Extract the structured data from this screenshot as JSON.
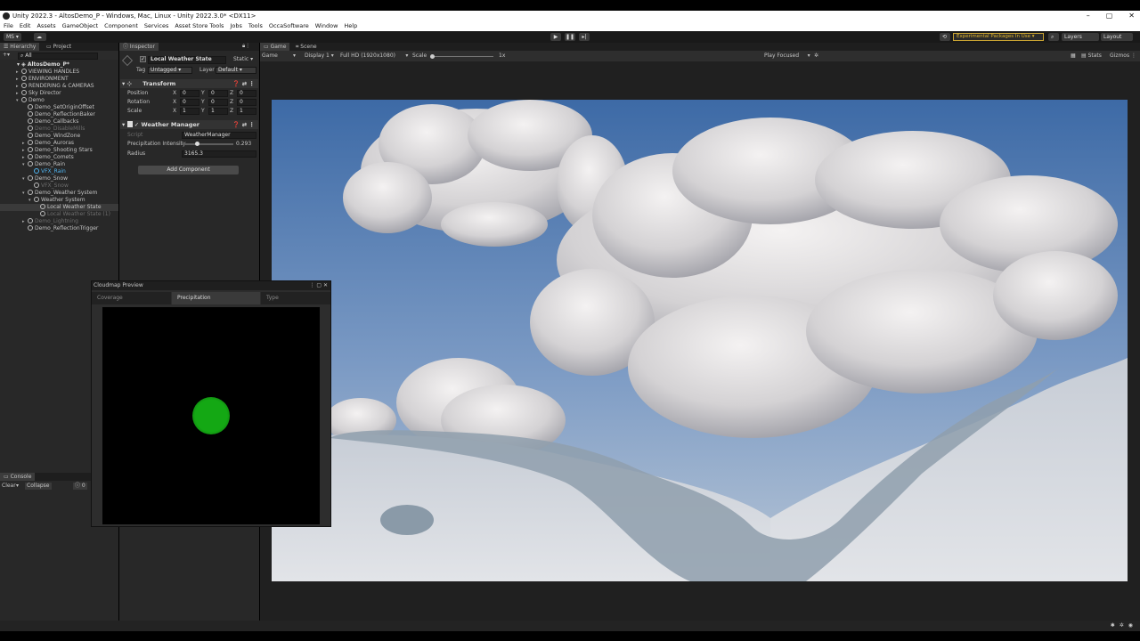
{
  "window": {
    "title": "Unity 2022.3 - AltosDemo_P - Windows, Mac, Linux - Unity 2022.3.0* <DX11>",
    "controls": [
      "–",
      "▢",
      "✕"
    ]
  },
  "menu": [
    "File",
    "Edit",
    "Assets",
    "GameObject",
    "Component",
    "Services",
    "Asset Store Tools",
    "Jobs",
    "Tools",
    "OccaSoftware",
    "Window",
    "Help"
  ],
  "toolbar": {
    "account": "MS ▾",
    "experimental": "Experimental Packages In Use ▾",
    "layers": "Layers",
    "layout": "Layout"
  },
  "hierarchy": {
    "tab": "Hierarchy",
    "project_tab": "Project",
    "search_placeholder": "All",
    "scene": "AltosDemo_P*",
    "items": [
      {
        "label": "VIEWING HANDLES",
        "indent": 1,
        "arrow": "▸"
      },
      {
        "label": "ENVIRONMENT",
        "indent": 1,
        "arrow": "▸"
      },
      {
        "label": "RENDERING & CAMERAS",
        "indent": 1,
        "arrow": "▸"
      },
      {
        "label": "Sky Director",
        "indent": 1,
        "arrow": "▸"
      },
      {
        "label": "Demo",
        "indent": 1,
        "arrow": "▾"
      },
      {
        "label": "Demo_SetOriginOffset",
        "indent": 2,
        "arrow": ""
      },
      {
        "label": "Demo_ReflectionBaker",
        "indent": 2,
        "arrow": ""
      },
      {
        "label": "Demo_Callbacks",
        "indent": 2,
        "arrow": ""
      },
      {
        "label": "Demo_DisableMills",
        "indent": 2,
        "arrow": "",
        "dim": true
      },
      {
        "label": "Demo_WindZone",
        "indent": 2,
        "arrow": ""
      },
      {
        "label": "Demo_Auroras",
        "indent": 2,
        "arrow": "▸"
      },
      {
        "label": "Demo_Shooting Stars",
        "indent": 2,
        "arrow": "▸"
      },
      {
        "label": "Demo_Comets",
        "indent": 2,
        "arrow": "▸"
      },
      {
        "label": "Demo_Rain",
        "indent": 2,
        "arrow": "▾"
      },
      {
        "label": "VFX_Rain",
        "indent": 3,
        "arrow": "",
        "blue": true
      },
      {
        "label": "Demo_Snow",
        "indent": 2,
        "arrow": "▾"
      },
      {
        "label": "VFX_Snow",
        "indent": 3,
        "arrow": "",
        "dim": true
      },
      {
        "label": "Demo_Weather System",
        "indent": 2,
        "arrow": "▾"
      },
      {
        "label": "Weather System",
        "indent": 3,
        "arrow": "▾"
      },
      {
        "label": "Local Weather State",
        "indent": 4,
        "arrow": "",
        "selected": true
      },
      {
        "label": "Local Weather State (1)",
        "indent": 4,
        "arrow": "",
        "dim": true
      },
      {
        "label": "Demo_Lightning",
        "indent": 2,
        "arrow": "▸",
        "dim": true
      },
      {
        "label": "Demo_ReflectionTrigger",
        "indent": 2,
        "arrow": ""
      }
    ]
  },
  "console": {
    "tab": "Console",
    "clear": "Clear",
    "collapse": "Collapse",
    "count": "0"
  },
  "inspector": {
    "tab": "Inspector",
    "object_name": "Local Weather State",
    "static": "Static",
    "tag_label": "Tag",
    "tag_value": "Untagged",
    "layer_label": "Layer",
    "layer_value": "Default",
    "transform": {
      "title": "Transform",
      "rows": [
        {
          "label": "Position",
          "x": "0",
          "y": "0",
          "z": "0"
        },
        {
          "label": "Rotation",
          "x": "0",
          "y": "0",
          "z": "0"
        },
        {
          "label": "Scale",
          "x": "1",
          "y": "1",
          "z": "1"
        }
      ]
    },
    "weather_manager": {
      "title": "Weather Manager",
      "script_label": "Script",
      "script_value": "WeatherManager",
      "precip_label": "Precipitation Intensity",
      "precip_value": "0.293",
      "precip_fraction": 0.293,
      "radius_label": "Radius",
      "radius_value": "3165.3"
    },
    "add_component": "Add Component"
  },
  "game": {
    "game_tab": "Game",
    "scene_tab": "Scene",
    "mode": "Game",
    "display": "Display 1",
    "resolution": "Full HD (1920x1080)",
    "scale_label": "Scale",
    "scale_value": "1x",
    "play_focused": "Play Focused",
    "stats": "Stats",
    "gizmos": "Gizmos"
  },
  "cloudmap": {
    "title": "Cloudmap Preview",
    "tabs": [
      "Coverage",
      "Precipitation",
      "Type"
    ],
    "active_tab": 1,
    "blob_color": "#14a814"
  }
}
